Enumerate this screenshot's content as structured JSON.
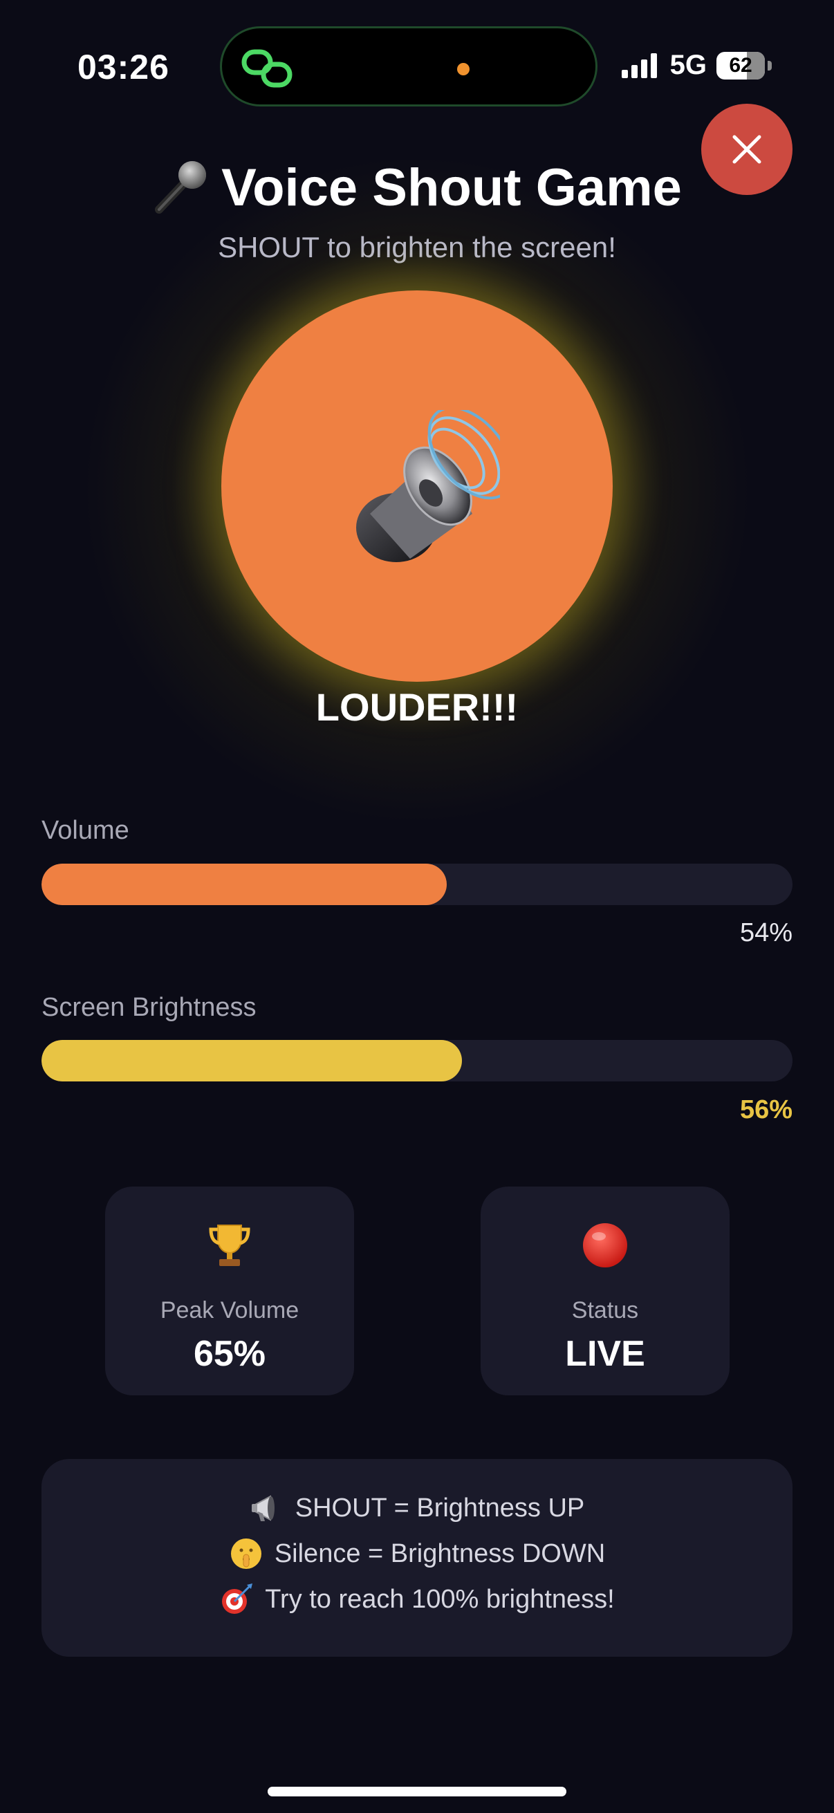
{
  "status_bar": {
    "time": "03:26",
    "network": "5G",
    "battery": "62"
  },
  "header": {
    "title": "Voice Shout Game",
    "subtitle": "SHOUT to brighten the screen!"
  },
  "game": {
    "prompt": "LOUDER!!!",
    "circle_color": "#ef8042",
    "glow_color": "#d2c328"
  },
  "meters": {
    "volume": {
      "label": "Volume",
      "value_text": "54%",
      "level": 0.54,
      "color": "#ef8042"
    },
    "brightness": {
      "label": "Screen Brightness",
      "value_text": "56%",
      "level": 0.56,
      "color": "#e8c444"
    }
  },
  "stats": {
    "peak": {
      "icon": "trophy-icon",
      "label": "Peak Volume",
      "value": "65%"
    },
    "status": {
      "icon": "red-circle-icon",
      "label": "Status",
      "value": "LIVE"
    }
  },
  "instructions": [
    {
      "icon": "megaphone-icon",
      "text": "SHOUT = Brightness UP"
    },
    {
      "icon": "shushing-face-icon",
      "text": "Silence = Brightness DOWN"
    },
    {
      "icon": "target-icon",
      "text": "Try to reach 100% brightness!"
    }
  ],
  "colors": {
    "background": "#0b0b16",
    "card": "#1a1a2a",
    "close_button": "#cc4a40"
  }
}
